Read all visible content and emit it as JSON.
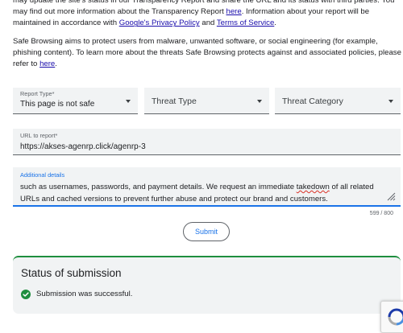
{
  "intro": {
    "p1": {
      "text_a": "may update the site's status in our Transparency Report and share the URL and its status with third parties. You may find out more information about the Transparency Report ",
      "link_here": "here",
      "text_b": ". Information about your report will be maintained in accordance with ",
      "link_privacy": "Google's Privacy Policy",
      "text_c": " and ",
      "link_terms": "Terms of Service",
      "text_d": "."
    },
    "p2": {
      "text_a": "Safe Browsing aims to protect users from malware, unwanted software, or social engineering (for example, phishing content). To learn more about the threats Safe Browsing protects against and associated policies, please refer to ",
      "link_here": "here",
      "text_b": "."
    }
  },
  "form": {
    "report_type": {
      "label": "Report Type*",
      "value": "This page is not safe"
    },
    "threat_type": {
      "placeholder": "Threat Type"
    },
    "threat_category": {
      "placeholder": "Threat Category"
    },
    "url": {
      "label": "URL to report*",
      "value": "https://akses-agenrp.click/agenrp-3"
    },
    "details": {
      "label": "Additional details",
      "line1_a": "such as usernames, passwords, and payment details. We request an immediate ",
      "line1_misspelled": "takedown",
      "line1_b": " of all related",
      "line2": "URLs and cached versions to prevent further abuse and protect our brand and customers."
    },
    "char_counter": "599 / 800",
    "submit_label": "Submit"
  },
  "status": {
    "title": "Status of submission",
    "message": "Submission was successful.",
    "icon": "check-circle-icon",
    "color": "#1e8e3e"
  },
  "colors": {
    "accent": "#1a73e8",
    "link": "#1a0dab",
    "success": "#1e8e3e",
    "field_bg": "#f1f3f4"
  }
}
